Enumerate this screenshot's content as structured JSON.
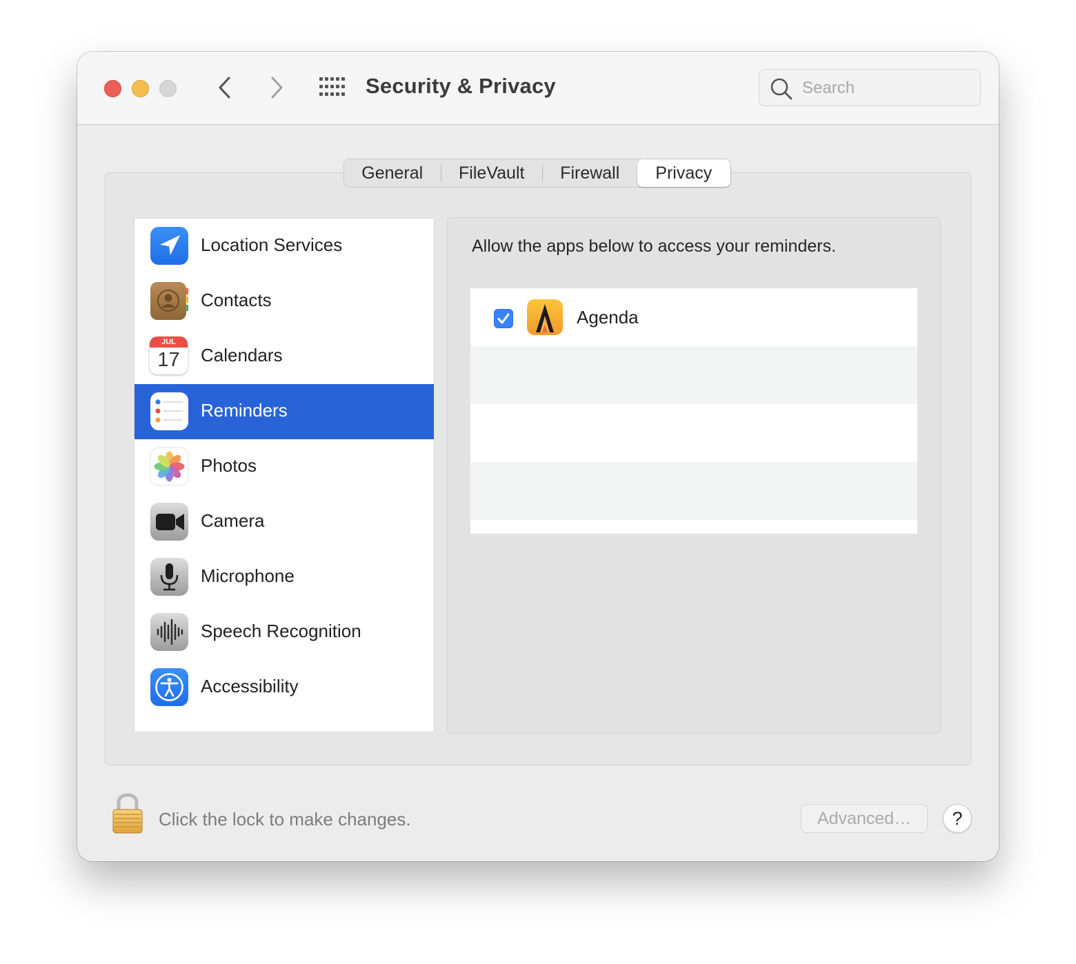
{
  "window": {
    "title": "Security & Privacy",
    "search_placeholder": "Search"
  },
  "tabs": [
    {
      "label": "General"
    },
    {
      "label": "FileVault"
    },
    {
      "label": "Firewall"
    },
    {
      "label": "Privacy",
      "selected": true
    }
  ],
  "sidebar": {
    "items": [
      {
        "label": "Location Services",
        "icon": "location-arrow-icon"
      },
      {
        "label": "Contacts",
        "icon": "contacts-book-icon"
      },
      {
        "label": "Calendars",
        "icon": "calendar-icon",
        "calendar_month": "JUL",
        "calendar_day": "17"
      },
      {
        "label": "Reminders",
        "icon": "reminders-list-icon",
        "selected": true
      },
      {
        "label": "Photos",
        "icon": "photos-flower-icon"
      },
      {
        "label": "Camera",
        "icon": "video-camera-icon"
      },
      {
        "label": "Microphone",
        "icon": "microphone-icon"
      },
      {
        "label": "Speech Recognition",
        "icon": "waveform-icon"
      },
      {
        "label": "Accessibility",
        "icon": "accessibility-figure-icon"
      }
    ],
    "selected_color": "#2864d8"
  },
  "content": {
    "description": "Allow the apps below to access your reminders.",
    "apps": [
      {
        "name": "Agenda",
        "checked": true,
        "icon": "agenda-app-icon"
      }
    ]
  },
  "footer": {
    "lock_text": "Click the lock to make changes.",
    "advanced_label": "Advanced…",
    "help_label": "?"
  }
}
